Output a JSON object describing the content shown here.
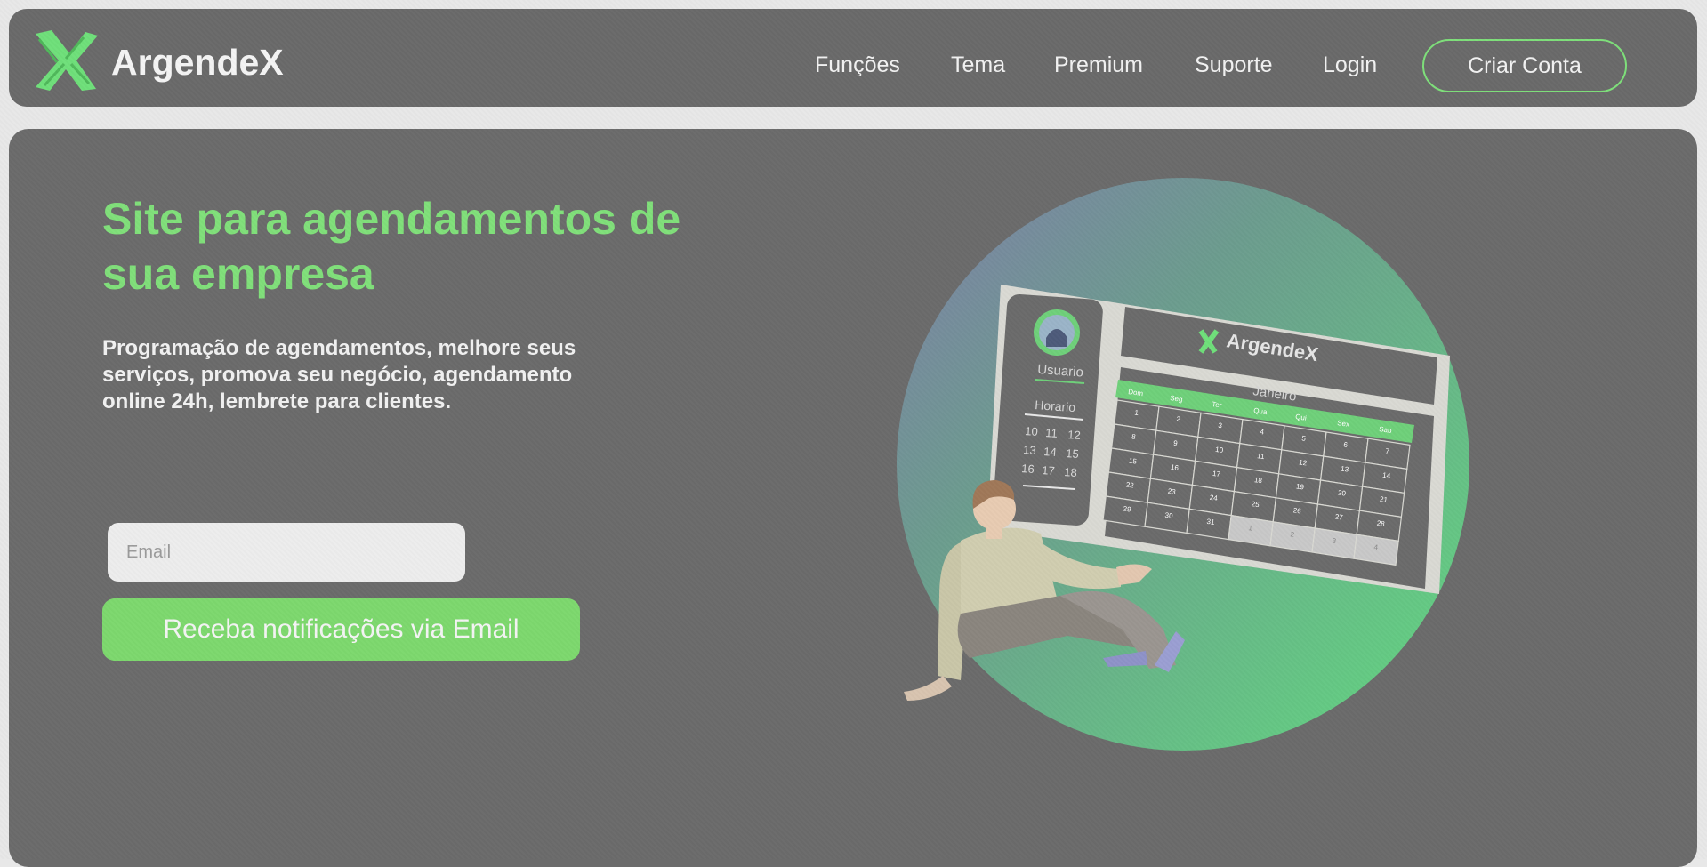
{
  "brand": {
    "name": "ArgendeX",
    "logo_icon": "green-x-logo-icon"
  },
  "nav": {
    "links": [
      "Funções",
      "Tema",
      "Premium",
      "Suporte",
      "Login"
    ],
    "cta": "Criar Conta"
  },
  "hero": {
    "title": "Site para agendamentos de sua empresa",
    "description": "Programação de agendamentos, melhore seus serviços, promova seu negócio, agendamento online 24h, lembrete para clientes.",
    "email_placeholder": "Email",
    "email_value": "",
    "button_label": "Receba notificações via Email"
  },
  "illustration": {
    "user_label": "Usuario",
    "schedule_label": "Horario",
    "hours": [
      "10",
      "11",
      "12",
      "13",
      "14",
      "15",
      "16",
      "17",
      "18"
    ],
    "brand": "ArgendeX",
    "month": "Janeiro",
    "weekdays": [
      "Dom",
      "Seg",
      "Ter",
      "Qua",
      "Qui",
      "Sex",
      "Sab"
    ],
    "weeks": [
      [
        "1",
        "2",
        "3",
        "4",
        "5",
        "6",
        "7"
      ],
      [
        "8",
        "9",
        "10",
        "11",
        "12",
        "13",
        "14"
      ],
      [
        "15",
        "16",
        "17",
        "18",
        "19",
        "20",
        "21"
      ],
      [
        "22",
        "23",
        "24",
        "25",
        "26",
        "27",
        "28"
      ],
      [
        "29",
        "30",
        "31",
        "1",
        "2",
        "3",
        "4"
      ]
    ]
  },
  "colors": {
    "accent": "#80e07a",
    "panel": "#6a6a6a",
    "page_background": "#e8e8e8"
  }
}
